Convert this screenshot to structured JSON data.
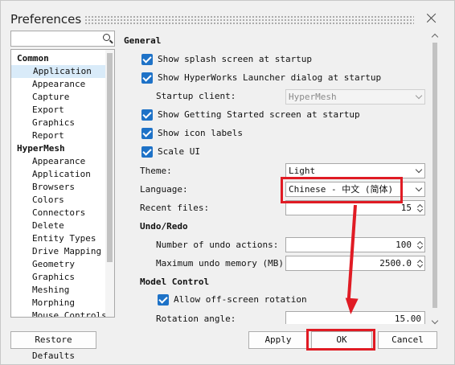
{
  "window": {
    "title": "Preferences"
  },
  "search": {
    "value": "",
    "placeholder": ""
  },
  "tree": {
    "rows": [
      {
        "label": "Common",
        "kind": "group"
      },
      {
        "label": "Application",
        "kind": "child",
        "selected": true
      },
      {
        "label": "Appearance",
        "kind": "child"
      },
      {
        "label": "Capture",
        "kind": "child"
      },
      {
        "label": "Export",
        "kind": "child"
      },
      {
        "label": "Graphics",
        "kind": "child"
      },
      {
        "label": "Report",
        "kind": "child"
      },
      {
        "label": "HyperMesh",
        "kind": "group"
      },
      {
        "label": "Appearance",
        "kind": "child"
      },
      {
        "label": "Application",
        "kind": "child"
      },
      {
        "label": "Browsers",
        "kind": "child"
      },
      {
        "label": "Colors",
        "kind": "child"
      },
      {
        "label": "Connectors",
        "kind": "child"
      },
      {
        "label": "Delete",
        "kind": "child"
      },
      {
        "label": "Entity Types",
        "kind": "child"
      },
      {
        "label": "Drive Mapping",
        "kind": "child"
      },
      {
        "label": "Geometry",
        "kind": "child"
      },
      {
        "label": "Graphics",
        "kind": "child"
      },
      {
        "label": "Meshing",
        "kind": "child"
      },
      {
        "label": "Morphing",
        "kind": "child"
      },
      {
        "label": "Mouse Controls",
        "kind": "child"
      }
    ]
  },
  "general": {
    "header": "General",
    "splash": "Show splash screen at startup",
    "launcher": "Show HyperWorks Launcher dialog at startup",
    "startup_client_label": "Startup client:",
    "startup_client_value": "HyperMesh",
    "getting_started": "Show Getting Started screen at startup",
    "icon_labels": "Show icon labels",
    "scale_ui": "Scale UI",
    "theme_label": "Theme:",
    "theme_value": "Light",
    "language_label": "Language:",
    "language_value": "Chinese - 中文 (简体)",
    "recent_label": "Recent files:",
    "recent_value": "15"
  },
  "undo": {
    "header": "Undo/Redo",
    "actions_label": "Number of undo actions:",
    "actions_value": "100",
    "memory_label": "Maximum undo memory (MB):",
    "memory_value": "2500.0"
  },
  "model": {
    "header": "Model Control",
    "offscreen": "Allow off-screen rotation",
    "rotation_label": "Rotation angle:",
    "rotation_value": "15.00"
  },
  "buttons": {
    "restore": "Restore Defaults",
    "apply": "Apply",
    "ok": "OK",
    "cancel": "Cancel"
  },
  "colors": {
    "accent": "#1e72c7",
    "annotation": "#e01b24",
    "selection": "#d9ebf9"
  }
}
